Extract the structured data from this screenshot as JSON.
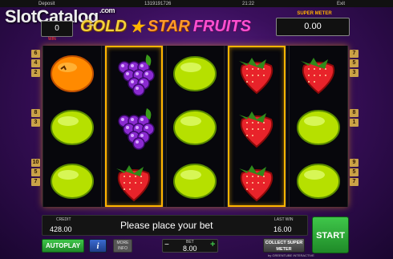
{
  "topbar": {
    "deposit": "Deposit",
    "session_id": "1319191726",
    "time": "21:22",
    "exit": "Exit"
  },
  "watermark": {
    "text": "SlotCatalog",
    "suffix": ".com"
  },
  "win": {
    "value": "0",
    "tag": "WIN"
  },
  "logo": {
    "word1": "GOLD",
    "word2": "STAR",
    "word3": "FRUITS"
  },
  "super_meter": {
    "label": "SUPER METER",
    "value": "0.00"
  },
  "line_numbers": {
    "left": [
      "6",
      "4",
      "2",
      "8",
      "3",
      "10",
      "5",
      "7"
    ],
    "right": [
      "7",
      "5",
      "3",
      "8",
      "1",
      "9",
      "5",
      "7"
    ]
  },
  "reels": [
    [
      "orange",
      "lime",
      "lime"
    ],
    [
      "grapes",
      "grapes",
      "strawberry"
    ],
    [
      "lime",
      "lime",
      "lime"
    ],
    [
      "strawberry",
      "strawberry",
      "strawberry"
    ],
    [
      "strawberry",
      "lime",
      "lime"
    ]
  ],
  "highlighted_reels": [
    1,
    3
  ],
  "credit": {
    "label": "CREDIT",
    "value": "428.00"
  },
  "message": "Please place your bet",
  "last_win": {
    "label": "LAST WIN",
    "value": "16.00"
  },
  "buttons": {
    "start": "START",
    "autoplay": "AUTOPLAY",
    "info": "i",
    "more_info": "MORE INFO",
    "collect": "COLLECT SUPER METER"
  },
  "bet": {
    "label": "BET",
    "value": "8.00",
    "minus": "−",
    "plus": "+"
  },
  "brand": "by GREENTUBE INTERACTIVE",
  "colors": {
    "accent": "#ffb400",
    "start": "#3fc64a",
    "background": "#3a0f5c"
  }
}
